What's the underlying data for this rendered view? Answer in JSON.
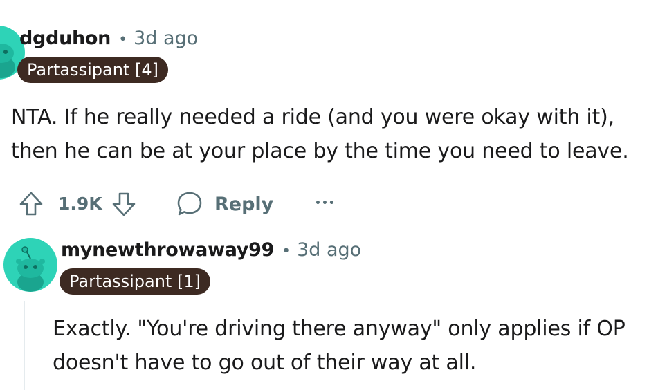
{
  "comments": [
    {
      "username": "dgduhon",
      "separator": "•",
      "time": "3d ago",
      "flair": "Partassipant [4]",
      "body_lines": [
        "NTA. If he really needed a ride (and you were okay with it),",
        "then he can be at your place by the time you need to leave."
      ],
      "votes": "1.9K",
      "reply_label": "Reply",
      "more_label": "•••"
    },
    {
      "username": "mynewthrowaway99",
      "separator": "•",
      "time": "3d ago",
      "flair": "Partassipant [1]",
      "body_lines": [
        "Exactly. \"You're driving there anyway\" only applies if OP",
        "doesn't have to go out of their way at all."
      ]
    }
  ],
  "icons": {
    "upvote": "upvote-arrow-icon",
    "downvote": "downvote-arrow-icon",
    "reply": "speech-bubble-icon",
    "more": "ellipsis-icon",
    "avatar": "snoo-avatar-icon"
  },
  "colors": {
    "avatar_bg": "#2ed3b7",
    "flair_bg": "#3d2a22",
    "meta_text": "#576f76"
  }
}
